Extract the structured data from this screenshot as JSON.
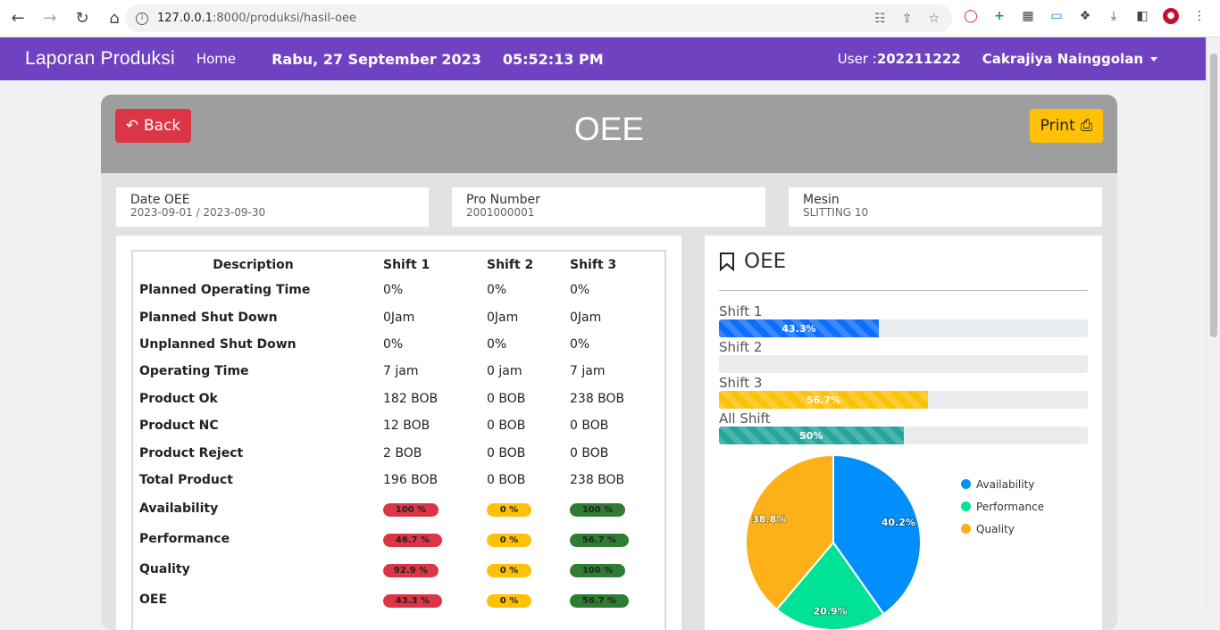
{
  "browser": {
    "url_host": "127.0.0.1",
    "url_path": ":8000/produksi/hasil-oee"
  },
  "appbar": {
    "brand": "Laporan Produksi",
    "home": "Home",
    "date": "Rabu, 27 September 2023",
    "time": "05:52:13 PM",
    "user_label": "User : ",
    "user_id": "202211222",
    "user_name": "Cakrajiya Nainggolan"
  },
  "header": {
    "back": "Back",
    "title": "OEE",
    "print": "Print"
  },
  "info": {
    "date_label": "Date OEE",
    "date_value": "2023-09-01 / 2023-09-30",
    "pro_label": "Pro Number",
    "pro_value": "2001000001",
    "mesin_label": "Mesin",
    "mesin_value": "SLITTING 10"
  },
  "table": {
    "headers": [
      "Description",
      "Shift 1",
      "Shift 2",
      "Shift 3"
    ],
    "rows": [
      [
        "Planned Operating Time",
        "0%",
        "0%",
        "0%"
      ],
      [
        "Planned Shut Down",
        "0Jam",
        "0Jam",
        "0Jam"
      ],
      [
        "Unplanned Shut Down",
        "0%",
        "0%",
        "0%"
      ],
      [
        "Operating Time",
        "7 jam",
        "0 jam",
        "7 jam"
      ],
      [
        "Product Ok",
        "182 BOB",
        "0 BOB",
        "238 BOB"
      ],
      [
        "Product NC",
        "12 BOB",
        "0 BOB",
        "0 BOB"
      ],
      [
        "Product Reject",
        "2 BOB",
        "0 BOB",
        "0 BOB"
      ],
      [
        "Total Product",
        "196 BOB",
        "0 BOB",
        "238 BOB"
      ]
    ],
    "badge_rows": [
      [
        "Availability",
        "100 %",
        "0 %",
        "100 %"
      ],
      [
        "Performance",
        "46.7 %",
        "0 %",
        "56.7 %"
      ],
      [
        "Quality",
        "92.9 %",
        "0 %",
        "100 %"
      ],
      [
        "OEE",
        "43.3 %",
        "0 %",
        "56.7 %"
      ]
    ],
    "badge_colors": [
      "#dc3545",
      "#ffc107",
      "#2e7d32"
    ]
  },
  "oee_panel": {
    "title": "OEE",
    "bars": [
      {
        "label": "Shift 1",
        "value": 43.3,
        "text": "43.3%",
        "color": "#0d6efd"
      },
      {
        "label": "Shift 2",
        "value": 0,
        "text": "",
        "color": "#0d6efd"
      },
      {
        "label": "Shift 3",
        "value": 56.7,
        "text": "56.7%",
        "color": "#ffc107"
      },
      {
        "label": "All Shift",
        "value": 50,
        "text": "50%",
        "color": "#26a69a"
      }
    ]
  },
  "chart_data": {
    "type": "pie",
    "categories": [
      "Availability",
      "Performance",
      "Quality"
    ],
    "values": [
      40.2,
      20.9,
      38.8
    ],
    "labels": [
      "40.2%",
      "20.9%",
      "38.8%"
    ],
    "colors": [
      "#008ffb",
      "#00e396",
      "#feb019"
    ],
    "legend": "right"
  }
}
